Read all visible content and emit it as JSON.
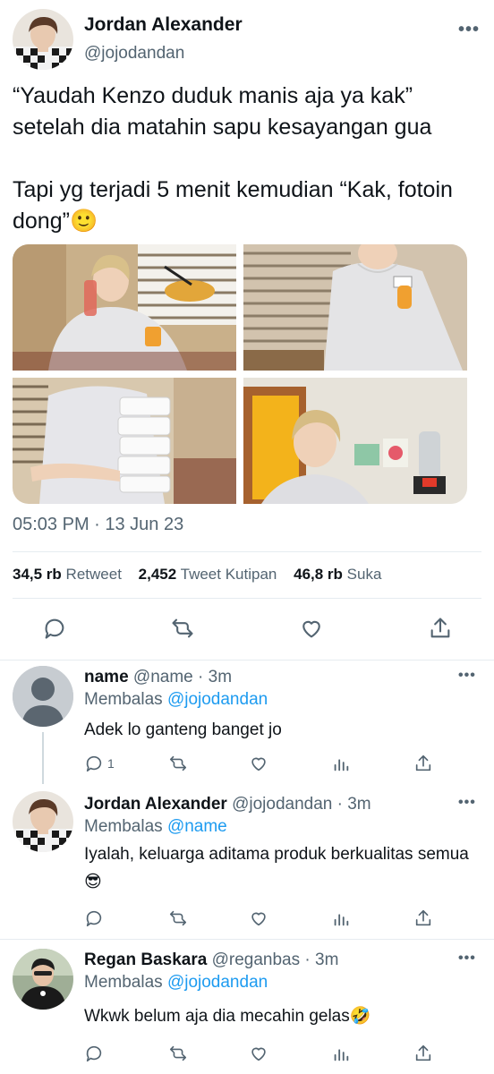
{
  "main_tweet": {
    "author_name": "Jordan Alexander",
    "author_handle": "@jojodandan",
    "more_label": "•••",
    "text": "“Yaudah Kenzo duduk manis aja ya kak” setelah dia matahin sapu kesayangan gua\n\nTapi yg terjadi 5 menit kemudian “Kak, fotoin dong”🙂",
    "timestamp": "05:03 PM · 13 Jun 23",
    "stats": {
      "retweets_count": "34,5 rb",
      "retweets_label": "Retweet",
      "quotes_count": "2,452",
      "quotes_label": "Tweet Kutipan",
      "likes_count": "46,8 rb",
      "likes_label": "Suka"
    }
  },
  "replies": [
    {
      "name": "name",
      "handle": "@name",
      "time": "3m",
      "replying_prefix": "Membalas",
      "replying_to": "@jojodandan",
      "text": "Adek lo ganteng banget jo",
      "reply_count": "1",
      "more_label": "•••"
    },
    {
      "name": "Jordan Alexander",
      "handle": "@jojodandan",
      "time": "3m",
      "replying_prefix": "Membalas",
      "replying_to": "@name",
      "text": "Iyalah, keluarga aditama produk berkualitas semua😎",
      "reply_count": "",
      "more_label": "•••"
    },
    {
      "name": "Regan Baskara",
      "handle": "@reganbas",
      "time": "3m",
      "replying_prefix": "Membalas",
      "replying_to": "@jojodandan",
      "text": "Wkwk belum aja dia mecahin gelas🤣",
      "reply_count": "",
      "more_label": "•••"
    }
  ],
  "separator": "·",
  "colors": {
    "text_primary": "#0f1419",
    "text_secondary": "#536471",
    "link": "#1d9bf0",
    "divider": "#e6ecf0"
  },
  "icons": [
    "reply-icon",
    "retweet-icon",
    "like-icon",
    "share-icon",
    "views-icon",
    "more-icon"
  ]
}
